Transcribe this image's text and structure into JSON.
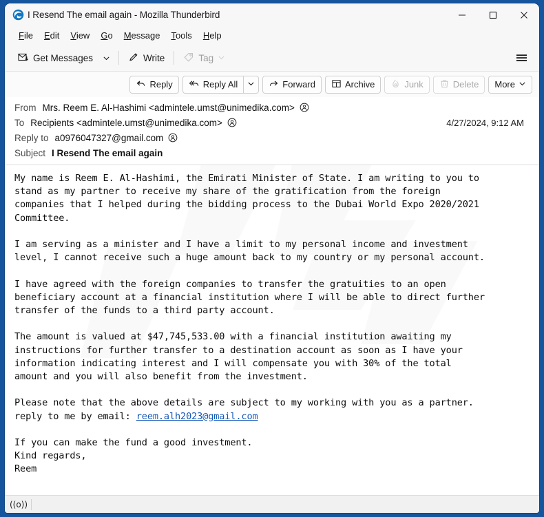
{
  "window": {
    "title": "I Resend The email again - Mozilla Thunderbird",
    "app_icon": "thunderbird-logo-icon",
    "frame_color": "#14559e",
    "controls": {
      "minimize": "–",
      "maximize": "□",
      "close": "✕"
    }
  },
  "menubar": {
    "items": [
      {
        "label": "File",
        "accesskey": "F"
      },
      {
        "label": "Edit",
        "accesskey": "E"
      },
      {
        "label": "View",
        "accesskey": "V"
      },
      {
        "label": "Go",
        "accesskey": "G"
      },
      {
        "label": "Message",
        "accesskey": "M"
      },
      {
        "label": "Tools",
        "accesskey": "T"
      },
      {
        "label": "Help",
        "accesskey": "H"
      }
    ]
  },
  "toolbar": {
    "get_messages": "Get Messages",
    "get_messages_icon": "envelope-download-icon",
    "get_messages_chevron": "chevron-down-icon",
    "write": "Write",
    "write_icon": "pencil-icon",
    "tag": "Tag",
    "tag_icon": "tag-icon",
    "tag_chevron": "chevron-down-icon",
    "tag_disabled": true,
    "app_menu_icon": "hamburger-menu-icon"
  },
  "message_actions": [
    {
      "label": "Reply",
      "icon": "reply-arrow-icon",
      "disabled": false
    },
    {
      "label": "Reply All",
      "icon": "reply-all-arrow-icon",
      "disabled": false
    },
    {
      "label": "Forward",
      "icon": "forward-arrow-icon",
      "disabled": false
    },
    {
      "label": "Archive",
      "icon": "archive-box-icon",
      "disabled": false
    },
    {
      "label": "Junk",
      "icon": "junk-flame-icon",
      "disabled": true
    },
    {
      "label": "Delete",
      "icon": "trash-can-icon",
      "disabled": true
    },
    {
      "label": "More",
      "icon": "chevron-down-icon",
      "disabled": false
    }
  ],
  "headers": {
    "from_label": "From",
    "from_value": "Mrs. Reem E. Al-Hashimi <admintele.umst@unimedika.com>",
    "to_label": "To",
    "to_value": "Recipients <admintele.umst@unimedika.com>",
    "reply_to_label": "Reply to",
    "reply_to_value": "a0976047327@gmail.com",
    "subject_label": "Subject",
    "subject_value": "I Resend The email again",
    "date": "4/27/2024, 9:12 AM",
    "contact_icon": "add-contact-circle-icon"
  },
  "body": {
    "paragraph_1": "My name is Reem E. Al-Hashimi, the Emirati Minister of State. I am writing to you to\nstand as my partner to receive my share of the gratification from the foreign\ncompanies that I helped during the bidding process to the Dubai World Expo 2020/2021\nCommittee.",
    "paragraph_2": "I am serving as a minister and I have a limit to my personal income and investment\nlevel, I cannot receive such a huge amount back to my country or my personal account.",
    "paragraph_3": "I have agreed with the foreign companies to transfer the gratuities to an open\nbeneficiary account at a financial institution where I will be able to direct further\ntransfer of the funds to a third party account.",
    "paragraph_4": "The amount is valued at $47,745,533.00 with a financial institution awaiting my\ninstructions for further transfer to a destination account as soon as I have your\ninformation indicating interest and I will compensate you with 30% of the total\namount and you will also benefit from the investment.",
    "paragraph_5_before": "Please note that the above details are subject to my working with you as a partner.\nreply to me by email: ",
    "paragraph_5_link": "reem.alh2023@gmail.com",
    "paragraph_6": "If you can make the fund a good investment.\nKind regards,\nReem",
    "link_color": "#1558b8",
    "amount": "$47,745,533.00",
    "percentage": "30%"
  },
  "statusbar": {
    "online_icon": "network-online-icon",
    "online_glyph": "((o))"
  }
}
